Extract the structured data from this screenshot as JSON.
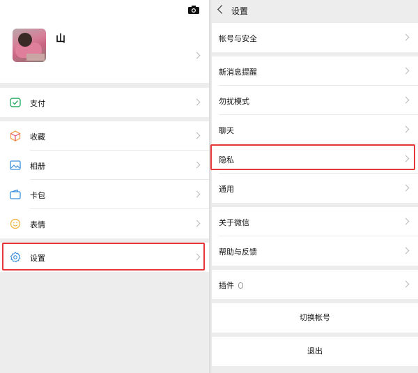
{
  "left": {
    "profile": {
      "name": "山",
      "camera_icon": "camera-icon"
    },
    "items": [
      {
        "label": "支付",
        "icon": "pay-icon",
        "color": "#2aae67"
      },
      {
        "label": "收藏",
        "icon": "favorites-icon",
        "color": "#f2a24a"
      },
      {
        "label": "相册",
        "icon": "album-icon",
        "color": "#3b8fdb"
      },
      {
        "label": "卡包",
        "icon": "card-wallet-icon",
        "color": "#3b8fdb"
      },
      {
        "label": "表情",
        "icon": "sticker-icon",
        "color": "#f2b33d"
      },
      {
        "label": "设置",
        "icon": "settings-icon",
        "color": "#3b8fdb"
      }
    ]
  },
  "right": {
    "title": "设置",
    "items": [
      {
        "label": "帐号与安全"
      },
      {
        "label": "新消息提醒"
      },
      {
        "label": "勿扰模式"
      },
      {
        "label": "聊天"
      },
      {
        "label": "隐私"
      },
      {
        "label": "通用"
      },
      {
        "label": "关于微信"
      },
      {
        "label": "帮助与反馈"
      },
      {
        "label": "插件"
      }
    ],
    "switch_account": "切换帐号",
    "logout": "退出"
  },
  "highlight_color": "#e5363a"
}
